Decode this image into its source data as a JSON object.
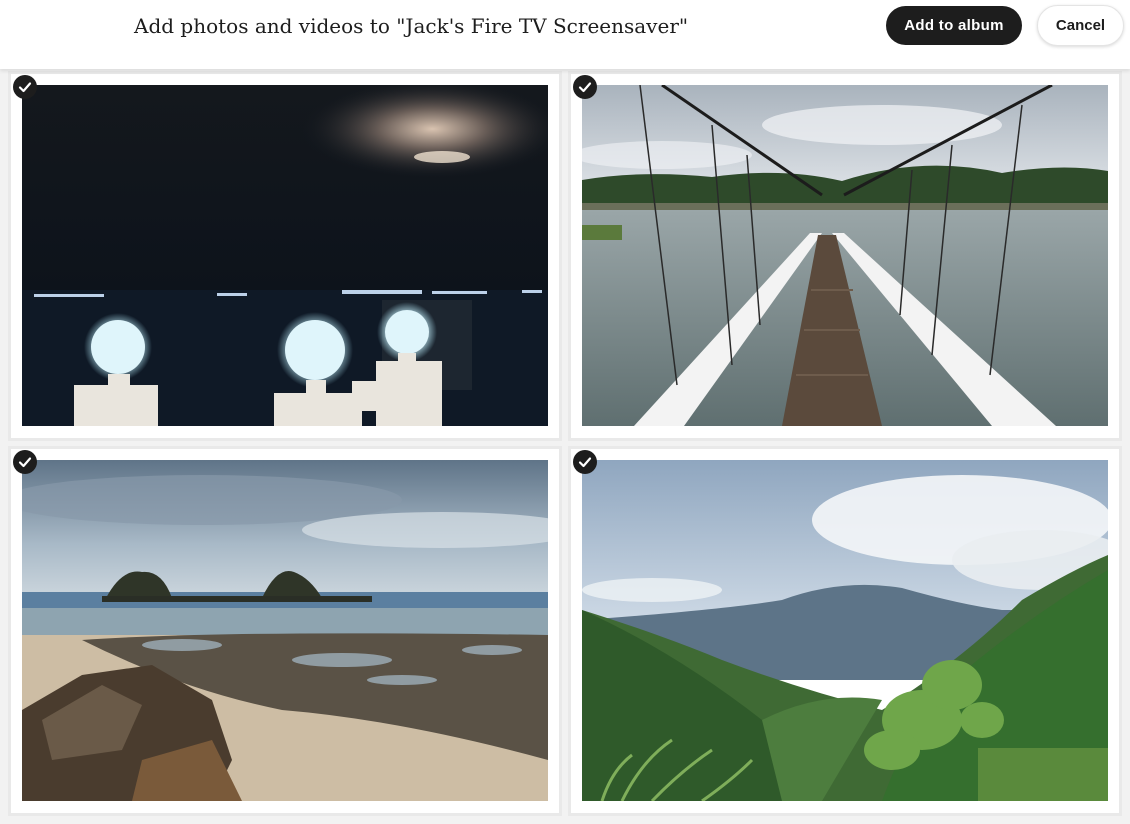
{
  "header": {
    "title": "Add photos and videos to \"Jack's Fire TV Screensaver\"",
    "add_label": "Add to album",
    "cancel_label": "Cancel"
  },
  "photos": [
    {
      "name": "night-sea-lamps",
      "selected": true
    },
    {
      "name": "suspension-bridge-river",
      "selected": true
    },
    {
      "name": "rocky-beach-islets",
      "selected": true
    },
    {
      "name": "mountain-valley-forest",
      "selected": true
    }
  ],
  "colors": {
    "primary_button": "#1d1d1d",
    "check_badge": "#1d1d1d",
    "tile_border": "#e9e9e9"
  }
}
